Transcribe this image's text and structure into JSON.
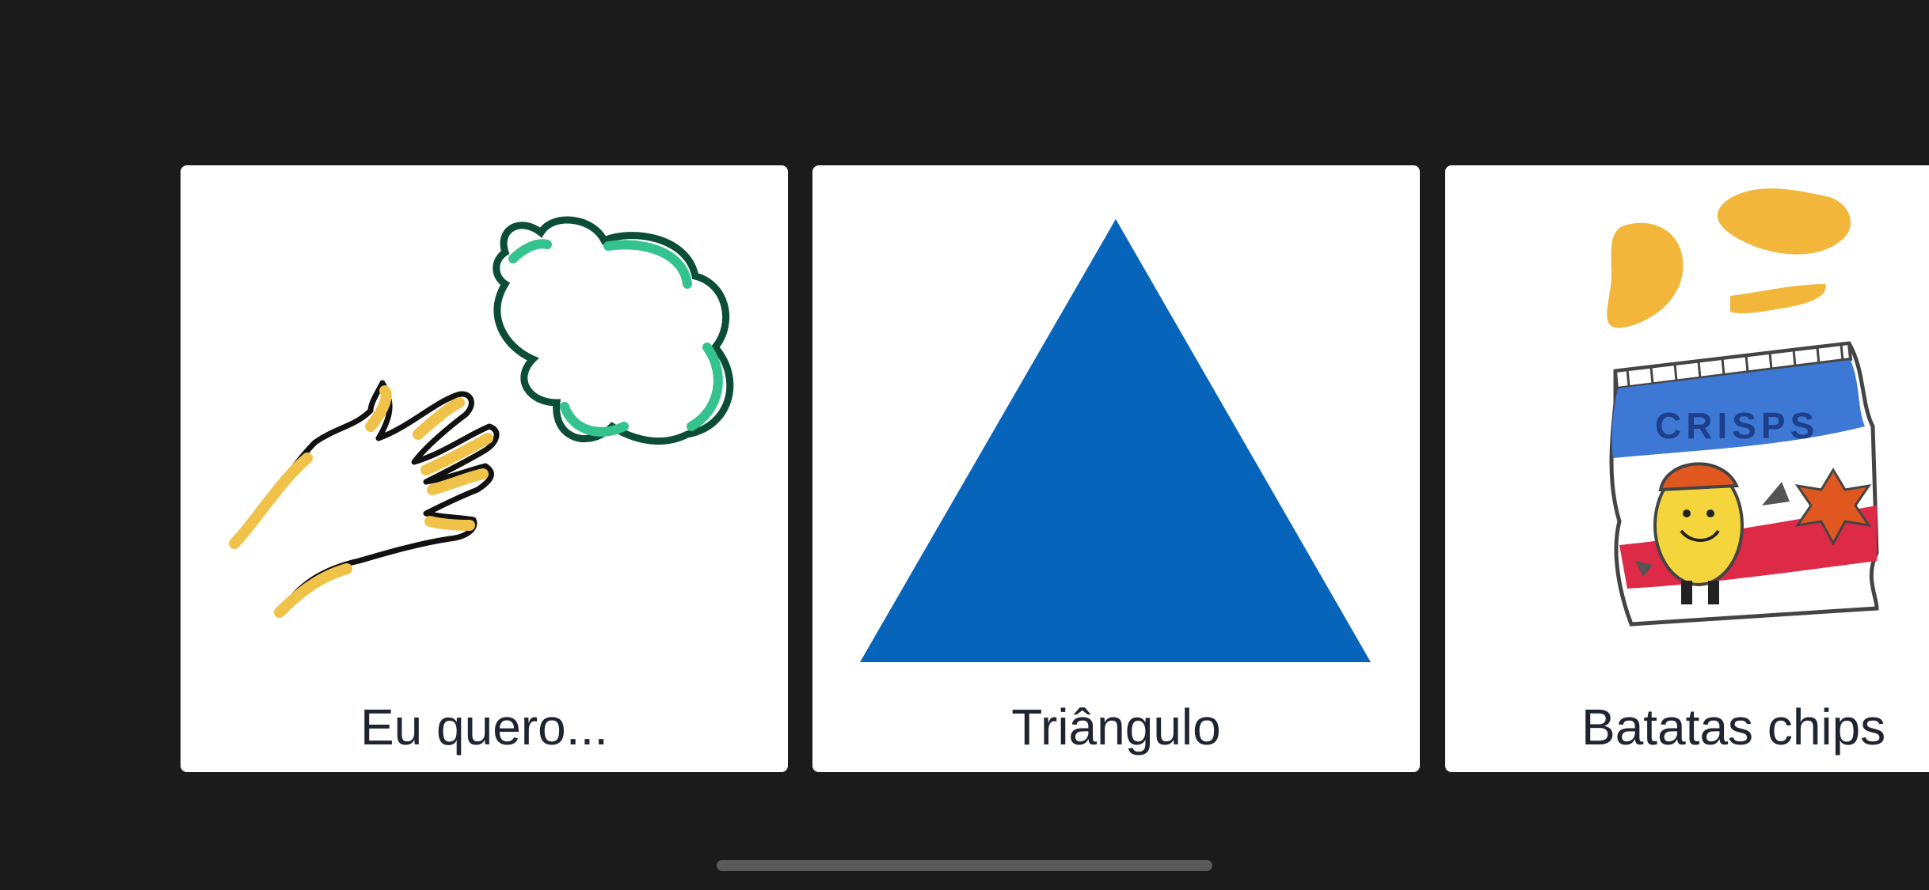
{
  "cards": [
    {
      "label": "Eu quero...",
      "icon": "want-hand-icon"
    },
    {
      "label": "Triângulo",
      "icon": "triangle-icon"
    },
    {
      "label": "Batatas chips",
      "icon": "potato-chips-icon",
      "image_text": "CRISPS"
    }
  ],
  "colors": {
    "background": "#1b1b1b",
    "card": "#ffffff",
    "label_text": "#1f2430",
    "triangle": "#0764bb",
    "hand": "#f0c24a",
    "cloud": "#34c38f"
  }
}
